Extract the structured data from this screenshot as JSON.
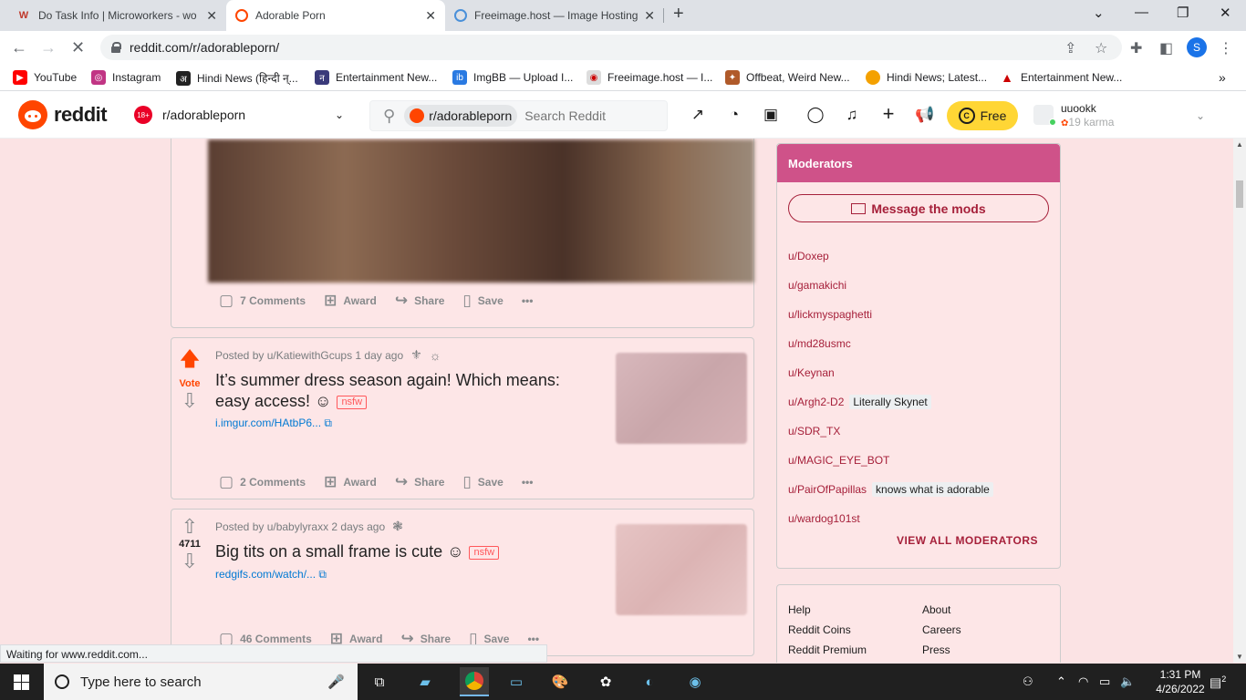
{
  "browser": {
    "tabs": [
      {
        "title": "Do Task Info | Microworkers - wo",
        "icon": "microworkers-icon"
      },
      {
        "title": "Adorable Porn",
        "icon": "reddit-icon"
      },
      {
        "title": "Freeimage.host — Image Hosting",
        "icon": "freeimage-icon"
      }
    ],
    "url": "reddit.com/r/adorableporn/",
    "profile_initial": "S",
    "bookmarks": [
      {
        "label": "YouTube",
        "color": "#ff0000"
      },
      {
        "label": "Instagram",
        "color": "#c13584"
      },
      {
        "label": "Hindi News (हिन्दी न्...",
        "color": "#222222"
      },
      {
        "label": "Entertainment New...",
        "color": "#3a3a7a"
      },
      {
        "label": "ImgBB — Upload I...",
        "color": "#2a7ae2"
      },
      {
        "label": "Freeimage.host — I...",
        "color": "#cccccc"
      },
      {
        "label": "Offbeat, Weird New...",
        "color": "#b05a2a"
      },
      {
        "label": "Hindi News; Latest...",
        "color": "#f4a100"
      },
      {
        "label": "Entertainment New...",
        "color": "#cc0000"
      }
    ],
    "status_text": "Waiting for www.reddit.com..."
  },
  "header": {
    "logo_text": "reddit",
    "community": "r/adorableporn",
    "community_badge": "18+",
    "search_pill": "r/adorableporn",
    "search_placeholder": "Search Reddit",
    "free_label": "Free",
    "username": "uuookk",
    "karma": "19 karma"
  },
  "posts": [
    {
      "comments": "7 Comments"
    },
    {
      "vote": "Vote",
      "author": "Posted by u/KatiewithGcups 1 day ago",
      "title": "It’s summer dress season again! Which means: easy access! ☺",
      "nsfw": "nsfw",
      "link": "i.imgur.com/HAtbP6...",
      "comments": "2 Comments"
    },
    {
      "vote": "4711",
      "author": "Posted by u/babylyraxx 2 days ago",
      "title": "Big tits on a small frame is cute ☺",
      "nsfw": "nsfw",
      "link": "redgifs.com/watch/...",
      "comments": "46 Comments"
    }
  ],
  "actions": {
    "award": "Award",
    "share": "Share",
    "save": "Save"
  },
  "moderators": {
    "title": "Moderators",
    "message_button": "Message the mods",
    "list": [
      {
        "name": "u/Doxep",
        "flair": ""
      },
      {
        "name": "u/gamakichi",
        "flair": ""
      },
      {
        "name": "u/lickmyspaghetti",
        "flair": ""
      },
      {
        "name": "u/md28usmc",
        "flair": ""
      },
      {
        "name": "u/Keynan",
        "flair": ""
      },
      {
        "name": "u/Argh2-D2",
        "flair": "Literally Skynet"
      },
      {
        "name": "u/SDR_TX",
        "flair": ""
      },
      {
        "name": "u/MAGIC_EYE_BOT",
        "flair": ""
      },
      {
        "name": "u/PairOfPapillas",
        "flair": "knows what is adorable"
      },
      {
        "name": "u/wardog101st",
        "flair": ""
      }
    ],
    "view_all": "VIEW ALL MODERATORS"
  },
  "footer": {
    "col1": [
      "Help",
      "Reddit Coins",
      "Reddit Premium"
    ],
    "col2": [
      "About",
      "Careers",
      "Press"
    ]
  },
  "taskbar": {
    "search_placeholder": "Type here to search",
    "time": "1:31 PM",
    "date": "4/26/2022",
    "notifications": "2"
  },
  "colors": {
    "mod_header": "#cf5289",
    "accent": "#a6203a",
    "upvote": "#ff4500",
    "page_bg": "#fbe3e4"
  }
}
